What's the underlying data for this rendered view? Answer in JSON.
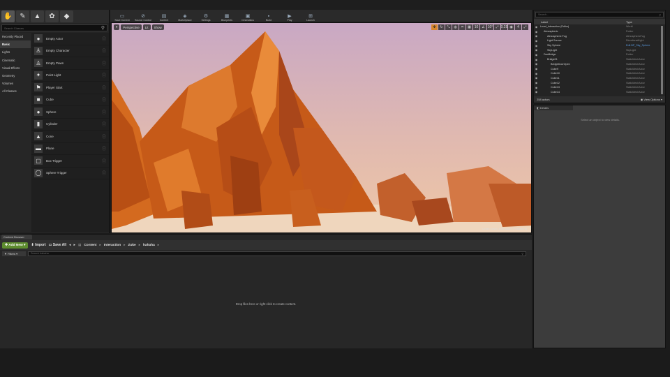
{
  "modes": {
    "tabs": [
      "place-icon",
      "paint-icon",
      "landscape-icon",
      "foliage-icon",
      "geometry-icon"
    ],
    "search_placeholder": "Search Classes",
    "categories": [
      "Recently Placed",
      "Basic",
      "Lights",
      "Cinematic",
      "Visual Effects",
      "Geometry",
      "Volumes",
      "All Classes"
    ],
    "active_category": "Basic",
    "items": [
      "Empty Actor",
      "Empty Character",
      "Empty Pawn",
      "Point Light",
      "Player Start",
      "Cube",
      "Sphere",
      "Cylinder",
      "Cone",
      "Plane",
      "Box Trigger",
      "Sphere Trigger"
    ]
  },
  "toolbar": {
    "buttons": [
      "Save Current",
      "Source Control",
      "Content",
      "Marketplace",
      "Settings",
      "Blueprints",
      "Cinematics",
      "Build",
      "Play",
      "Launch"
    ]
  },
  "viewport": {
    "options": [
      "Perspective",
      "Lit",
      "Show"
    ],
    "grid_snap": "10",
    "rot_snap": "10°",
    "scale_snap": "0.25",
    "camera_speed": "4",
    "level_label": "Level: Level_Interaction (Persistent)"
  },
  "content_browser": {
    "tab": "Content Browser",
    "add_new": "Add New",
    "import": "Import",
    "save_all": "Save All",
    "breadcrumb": [
      "Content",
      "Interaction",
      "Zuke",
      "hahaha"
    ],
    "filters": "Filters",
    "search_placeholder": "Search hahaha",
    "drop_message": "Drop files here or right click to create content."
  },
  "outliner": {
    "search_placeholder": "Search...",
    "col_label": "Label",
    "col_type": "Type",
    "rows": [
      {
        "name": "Level_Interaction (Editor)",
        "type": "World",
        "indent": 0
      },
      {
        "name": "Atmospheric",
        "type": "Folder",
        "indent": 1
      },
      {
        "name": "Atmospheric Fog",
        "type": "AtmosphericFog",
        "indent": 2
      },
      {
        "name": "Light Source",
        "type": "DirectionalLight",
        "indent": 2
      },
      {
        "name": "Sky Sphere",
        "type": "Edit BP_Sky_Sphere",
        "indent": 2,
        "link": true
      },
      {
        "name": "SkyLight",
        "type": "SkyLight",
        "indent": 2
      },
      {
        "name": "DanBridge",
        "type": "Folder",
        "indent": 1
      },
      {
        "name": "Bridge01",
        "type": "StaticMeshActor",
        "indent": 2
      },
      {
        "name": "BridgeDoorOpen",
        "type": "StaticMeshActor",
        "indent": 3
      },
      {
        "name": "Cube9",
        "type": "StaticMeshActor",
        "indent": 3
      },
      {
        "name": "Cube10",
        "type": "StaticMeshActor",
        "indent": 3
      },
      {
        "name": "Cube11",
        "type": "StaticMeshActor",
        "indent": 3
      },
      {
        "name": "Cube12",
        "type": "StaticMeshActor",
        "indent": 3
      },
      {
        "name": "Cube13",
        "type": "StaticMeshActor",
        "indent": 3
      },
      {
        "name": "Cube14",
        "type": "StaticMeshActor",
        "indent": 3
      }
    ],
    "actor_count": "258 actors",
    "view_options": "View Options"
  },
  "details": {
    "tab": "Details",
    "message": "Select an object to view details."
  }
}
